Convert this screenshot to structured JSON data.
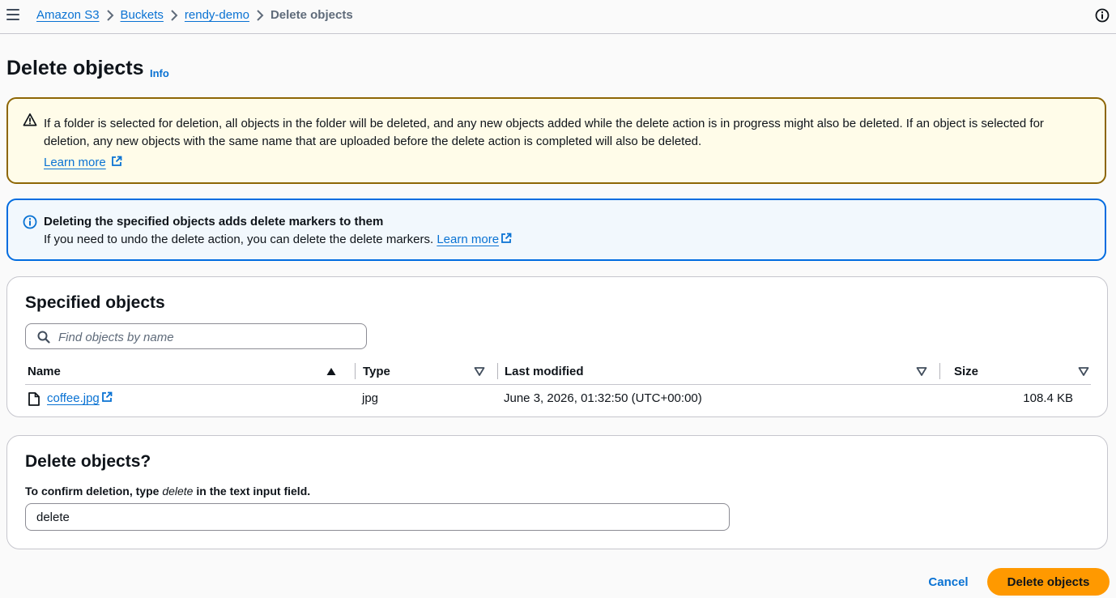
{
  "breadcrumb": {
    "items": [
      "Amazon S3",
      "Buckets",
      "rendy-demo"
    ],
    "current": "Delete objects"
  },
  "page": {
    "title": "Delete objects",
    "info_label": "Info"
  },
  "warning_alert": {
    "text": "If a folder is selected for deletion, all objects in the folder will be deleted, and any new objects added while the delete action is in progress might also be deleted. If an object is selected for deletion, any new objects with the same name that are uploaded before the delete action is completed will also be deleted.",
    "learn_more": "Learn more"
  },
  "info_alert": {
    "title": "Deleting the specified objects adds delete markers to them",
    "text": "If you need to undo the delete action, you can delete the delete markers.",
    "learn_more": "Learn more"
  },
  "objects_section": {
    "title": "Specified objects",
    "search_placeholder": "Find objects by name",
    "columns": [
      "Name",
      "Type",
      "Last modified",
      "Size"
    ],
    "rows": [
      {
        "name": "coffee.jpg",
        "type": "jpg",
        "last_modified": "June 3, 2026, 01:32:50 (UTC+00:00)",
        "size": "108.4 KB"
      }
    ]
  },
  "confirm_section": {
    "title": "Delete objects?",
    "label_prefix": "To confirm deletion, type",
    "label_keyword": "delete",
    "label_suffix": "in the text input field.",
    "input_value": "delete"
  },
  "actions": {
    "cancel": "Cancel",
    "delete": "Delete objects"
  },
  "colors": {
    "link": "#0972d3",
    "primary_button": "#ff9900",
    "warning_border": "#8d6605",
    "info_border": "#006ce0"
  }
}
